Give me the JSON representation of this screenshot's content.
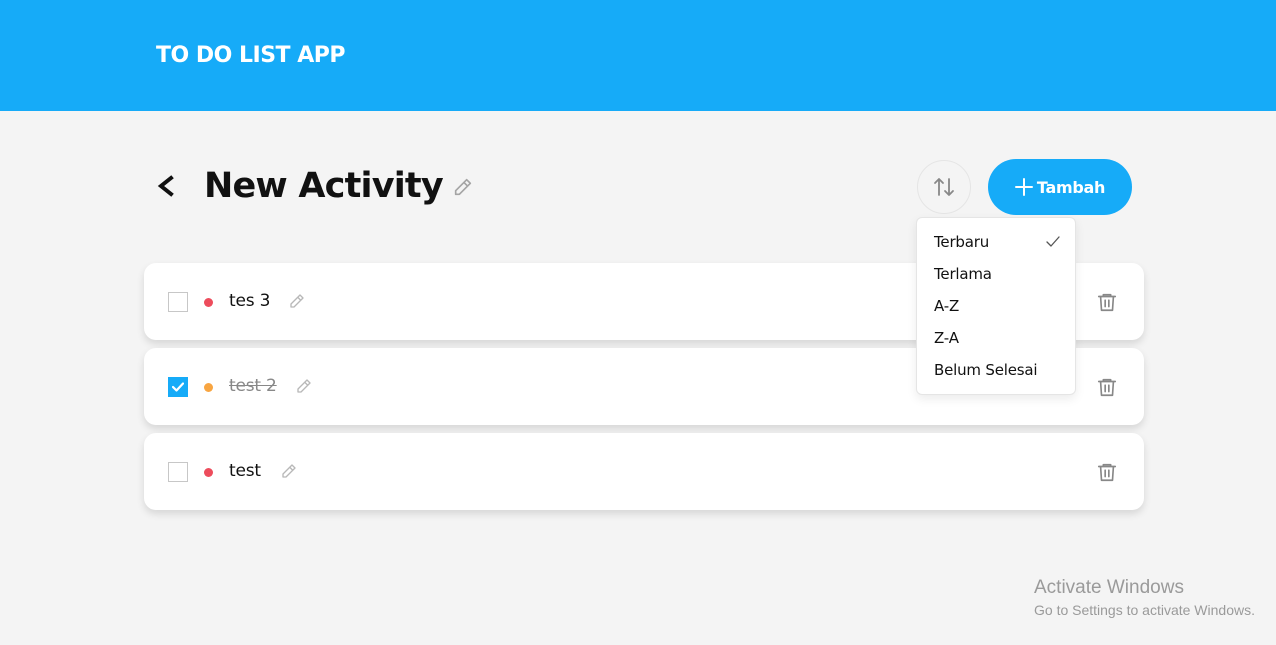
{
  "header": {
    "app_title": "TO DO LIST APP"
  },
  "activity": {
    "title": "New Activity"
  },
  "toolbar": {
    "add_label": "Tambah"
  },
  "sort_menu": {
    "options": [
      "Terbaru",
      "Terlama",
      "A-Z",
      "Z-A",
      "Belum Selesai"
    ],
    "selected": "Terbaru"
  },
  "todos": [
    {
      "title": "tes 3",
      "done": false,
      "priority_color": "#ed4c5c"
    },
    {
      "title": "test 2",
      "done": true,
      "priority_color": "#f8a541"
    },
    {
      "title": "test",
      "done": false,
      "priority_color": "#ed4c5c"
    }
  ],
  "watermark": {
    "title": "Activate Windows",
    "subtitle": "Go to Settings to activate Windows."
  },
  "colors": {
    "primary": "#16abf8",
    "very_high": "#ed4c5c",
    "high": "#f8a541"
  }
}
